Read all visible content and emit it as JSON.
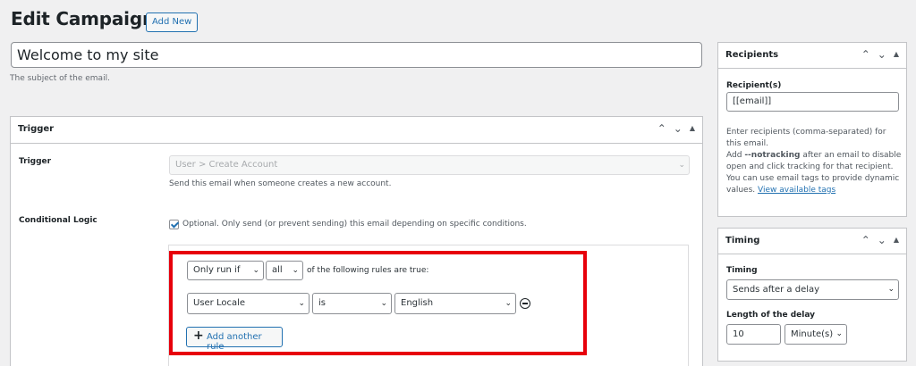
{
  "header": {
    "title": "Edit Campaign",
    "add_new_label": "Add New"
  },
  "subject": {
    "value": "Welcome to my site",
    "description": "The subject of the email."
  },
  "trigger_box": {
    "title": "Trigger",
    "trigger_label": "Trigger",
    "trigger_select_value": "User > Create Account",
    "trigger_description": "Send this email when someone creates a new account.",
    "conditional_label": "Conditional Logic",
    "conditional_checkbox_text": "Optional. Only send (or prevent sending) this email depending on specific conditions.",
    "rules": {
      "run_mode": "Only run if",
      "match": "all",
      "match_suffix": "of the following rules are true:",
      "rule_field": "User Locale",
      "rule_operator": "is",
      "rule_value": "English",
      "add_rule_label": "Add another rule"
    }
  },
  "recipients_box": {
    "title": "Recipients",
    "label": "Recipient(s)",
    "value": "[[email]]",
    "desc_1": "Enter recipients (comma-separated) for this email.",
    "desc_2_prefix": "Add",
    "desc_2_code": "--notracking",
    "desc_2_suffix": "after an email to disable open and click tracking for that recipient.",
    "desc_3": "You can use email tags to provide dynamic values.",
    "tags_link": "View available tags"
  },
  "timing_box": {
    "title": "Timing",
    "timing_label": "Timing",
    "timing_value": "Sends after a delay",
    "delay_label": "Length of the delay",
    "delay_value": "10",
    "delay_unit": "Minute(s)"
  },
  "colors": {
    "accent": "#2271b1",
    "highlight": "#e7000b"
  },
  "icons": {
    "up": "chevron-up-icon",
    "down": "chevron-down-icon",
    "toggle": "triangle-up-icon",
    "remove": "minus-circle-icon",
    "add": "plus-icon"
  }
}
